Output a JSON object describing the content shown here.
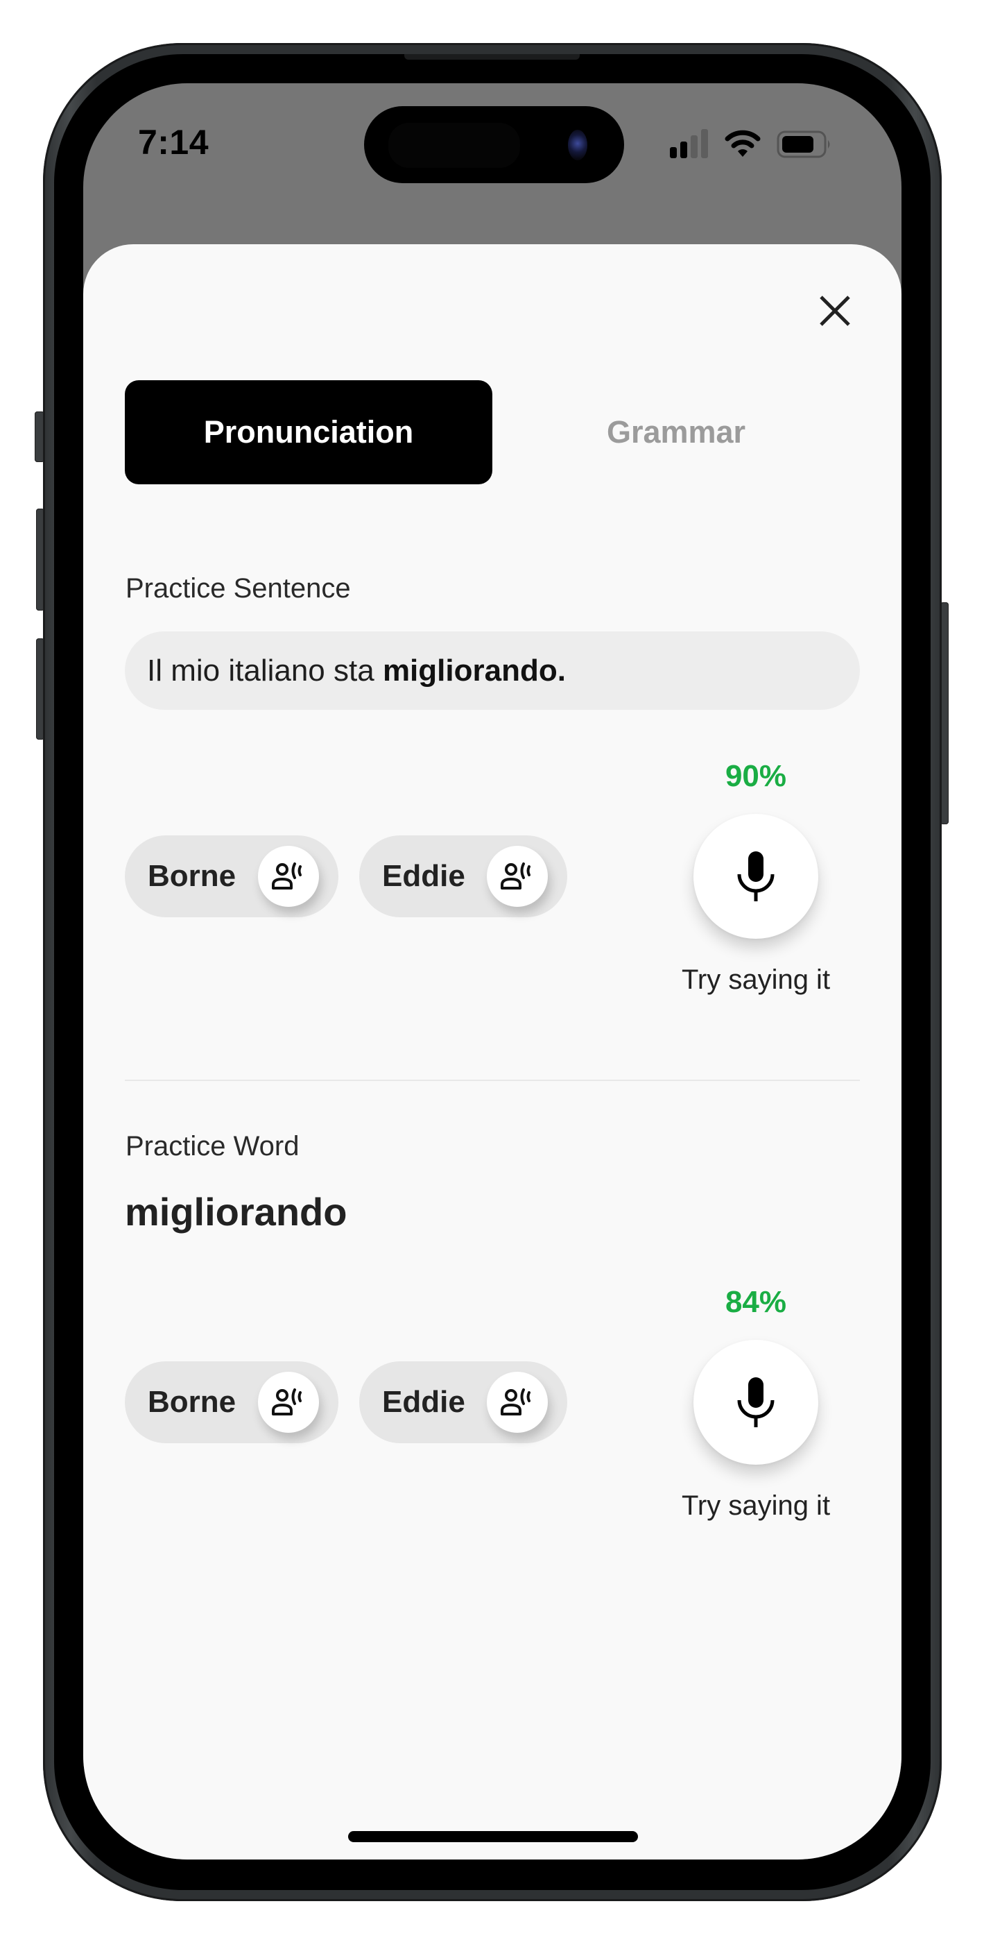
{
  "status_bar": {
    "time": "7:14",
    "signal_bars_active": 2,
    "signal_bars_total": 4,
    "battery_level_percent": 80,
    "icons": [
      "cellular-signal-icon",
      "wifi-icon",
      "battery-icon"
    ]
  },
  "header": {
    "close_icon": "close-icon"
  },
  "tabs": [
    {
      "label": "Pronunciation",
      "active": true
    },
    {
      "label": "Grammar",
      "active": false
    }
  ],
  "sentence_section": {
    "title": "Practice Sentence",
    "sentence_prefix": "Il mio italiano sta ",
    "sentence_highlight": "migliorando.",
    "voices": [
      {
        "name": "Borne",
        "icon": "voice-speaker-icon"
      },
      {
        "name": "Eddie",
        "icon": "voice-speaker-icon"
      }
    ],
    "score": "90%",
    "mic_icon": "microphone-icon",
    "try_label": "Try saying it"
  },
  "word_section": {
    "title": "Practice Word",
    "word": "migliorando",
    "voices": [
      {
        "name": "Borne",
        "icon": "voice-speaker-icon"
      },
      {
        "name": "Eddie",
        "icon": "voice-speaker-icon"
      }
    ],
    "score": "84%",
    "mic_icon": "microphone-icon",
    "try_label": "Try saying it"
  },
  "colors": {
    "score_green": "#1aad44",
    "active_tab_bg": "#000000",
    "inactive_tab_text": "#9b9b9b",
    "sheet_bg": "#f9f9f9",
    "pill_bg": "#e6e6e6",
    "backdrop": "#767676"
  }
}
